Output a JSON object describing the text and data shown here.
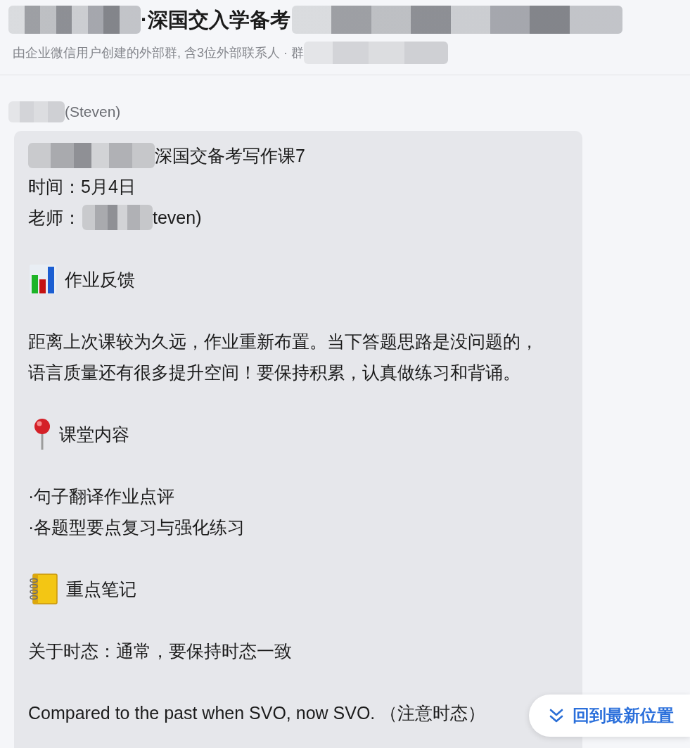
{
  "header": {
    "title": {
      "text": "·深国交入学备考",
      "redacted_before": true,
      "redacted_after": true
    },
    "subtitle": {
      "text": "由企业微信用户创建的外部群, 含3位外部联系人 · 群",
      "redacted_after": true
    }
  },
  "message": {
    "sender": {
      "text": "(Steven)",
      "redacted_before": true
    },
    "blocks": [
      {
        "kind": "lines",
        "lines": [
          {
            "parts": [
              {
                "text": "深国交备考写作课7",
                "redacted_before": true
              }
            ]
          },
          {
            "parts": [
              {
                "text": "时间：5月4日",
                "redacted_before": false
              }
            ]
          },
          {
            "parts": [
              {
                "text": "老师：",
                "redacted_before": false
              },
              {
                "text": "teven)",
                "redacted_before": true
              }
            ]
          }
        ]
      },
      {
        "kind": "heading",
        "text": "作业反馈"
      },
      {
        "kind": "paragraph",
        "text": "距离上次课较为久远，作业重新布置。当下答题思路是没问题的，语言质量还有很多提升空间！要保持积累，认真做练习和背诵。"
      },
      {
        "kind": "heading",
        "text": "课堂内容"
      },
      {
        "kind": "lines",
        "lines": [
          {
            "parts": [
              {
                "text": "·句子翻译作业点评",
                "redacted_before": false
              }
            ]
          },
          {
            "parts": [
              {
                "text": "·各题型要点复习与强化练习",
                "redacted_before": false
              }
            ]
          }
        ]
      },
      {
        "kind": "heading",
        "text": "重点笔记"
      },
      {
        "kind": "paragraph",
        "text": "关于时态：通常，要保持时态一致"
      },
      {
        "kind": "paragraph",
        "text": "Compared to the past when SVO, now SVO. （注意时态）"
      }
    ]
  },
  "jump_button": {
    "label": "回到最新位置"
  }
}
